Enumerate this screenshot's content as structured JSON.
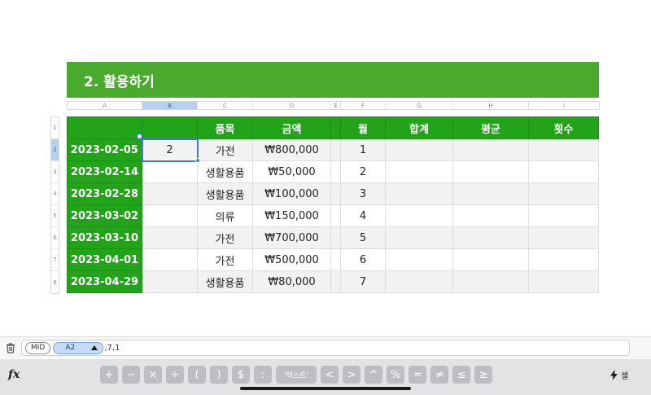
{
  "sheet": {
    "title": "2. 활용하기",
    "column_letters": [
      "A",
      "B",
      "C",
      "D",
      "E",
      "F",
      "G",
      "H",
      "I"
    ],
    "selected_column": "B",
    "row_numbers": [
      "1",
      "2",
      "3",
      "4",
      "5",
      "6",
      "7",
      "8"
    ],
    "selected_row": "2",
    "header_row": [
      "",
      "",
      "품목",
      "금액",
      "",
      "월",
      "합계",
      "평균",
      "횟수"
    ],
    "rows": [
      [
        "2023-02-05",
        "2",
        "가전",
        "₩800,000",
        "",
        "1",
        "",
        "",
        ""
      ],
      [
        "2023-02-14",
        "",
        "생활용품",
        "₩50,000",
        "",
        "2",
        "",
        "",
        ""
      ],
      [
        "2023-02-28",
        "",
        "생활용품",
        "₩100,000",
        "",
        "3",
        "",
        "",
        ""
      ],
      [
        "2023-03-02",
        "",
        "의류",
        "₩150,000",
        "",
        "4",
        "",
        "",
        ""
      ],
      [
        "2023-03-10",
        "",
        "가전",
        "₩700,000",
        "",
        "5",
        "",
        "",
        ""
      ],
      [
        "2023-04-01",
        "",
        "가전",
        "₩500,000",
        "",
        "6",
        "",
        "",
        ""
      ],
      [
        "2023-04-29",
        "",
        "생활용품",
        "₩80,000",
        "",
        "7",
        "",
        "",
        ""
      ]
    ],
    "active_cell": "B2"
  },
  "formula": {
    "function_token": "MID",
    "ref_token": "A2",
    "ref_dropdown_icon": "triangle-up-icon",
    "rest": ",7,1"
  },
  "keyboard": {
    "fx_label": "fx",
    "keys": [
      "+",
      "−",
      "×",
      "÷",
      "(",
      ")",
      "$",
      ":",
      "‘텍스트’",
      "<",
      ">",
      "^",
      "%",
      "=",
      "≠",
      "≤",
      "≥"
    ],
    "cell_button_label": "셀"
  },
  "colors": {
    "title_green": "#4aaa2e",
    "header_green": "#22a31a",
    "selection_blue": "#3a7bd5"
  }
}
